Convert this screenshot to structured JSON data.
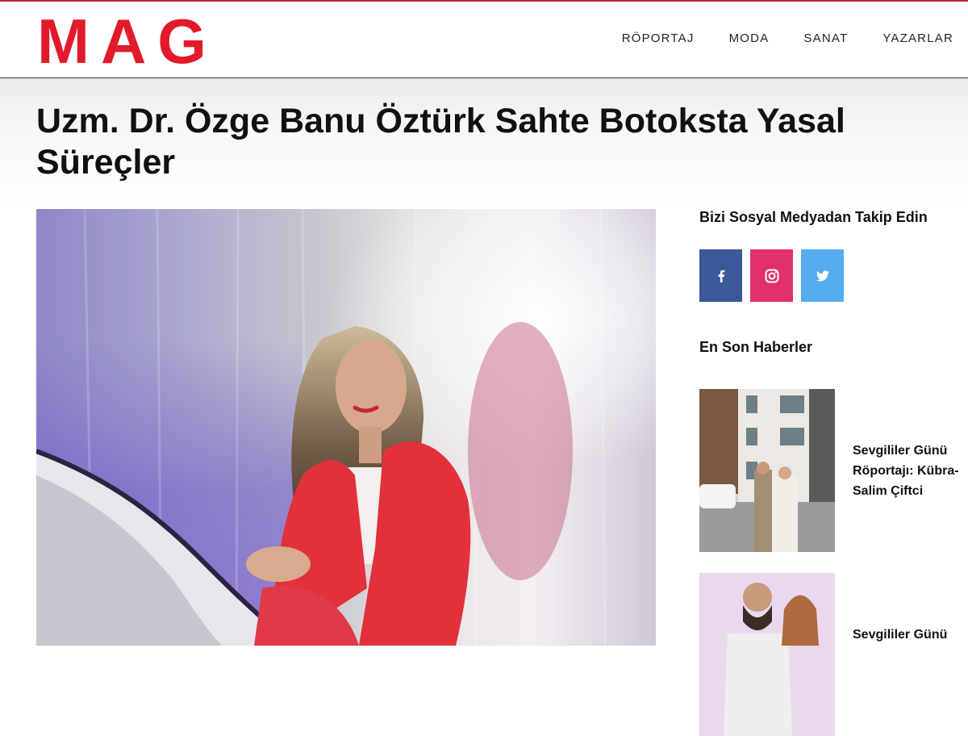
{
  "site": {
    "logo": "MAG"
  },
  "nav": {
    "items": [
      {
        "label": "RÖPORTAJ"
      },
      {
        "label": "MODA"
      },
      {
        "label": "SANAT"
      },
      {
        "label": "YAZARLAR"
      }
    ]
  },
  "article": {
    "title": "Uzm. Dr. Özge Banu Öztürk Sahte Botoksta Yasal Süreçler"
  },
  "sidebar": {
    "social": {
      "heading": "Bizi Sosyal Medyadan Takip Edin",
      "facebook_icon": "facebook-icon",
      "instagram_icon": "instagram-icon",
      "twitter_icon": "twitter-icon"
    },
    "latest": {
      "heading": "En Son Haberler",
      "items": [
        {
          "title": "Sevgililer Günü Röportajı: Kübra-Salim Çiftci"
        },
        {
          "title": "Sevgililer Günü"
        }
      ]
    }
  },
  "colors": {
    "brand": "#e21b2b",
    "facebook": "#3b5998",
    "instagram": "#e1306c",
    "twitter": "#55acee"
  }
}
